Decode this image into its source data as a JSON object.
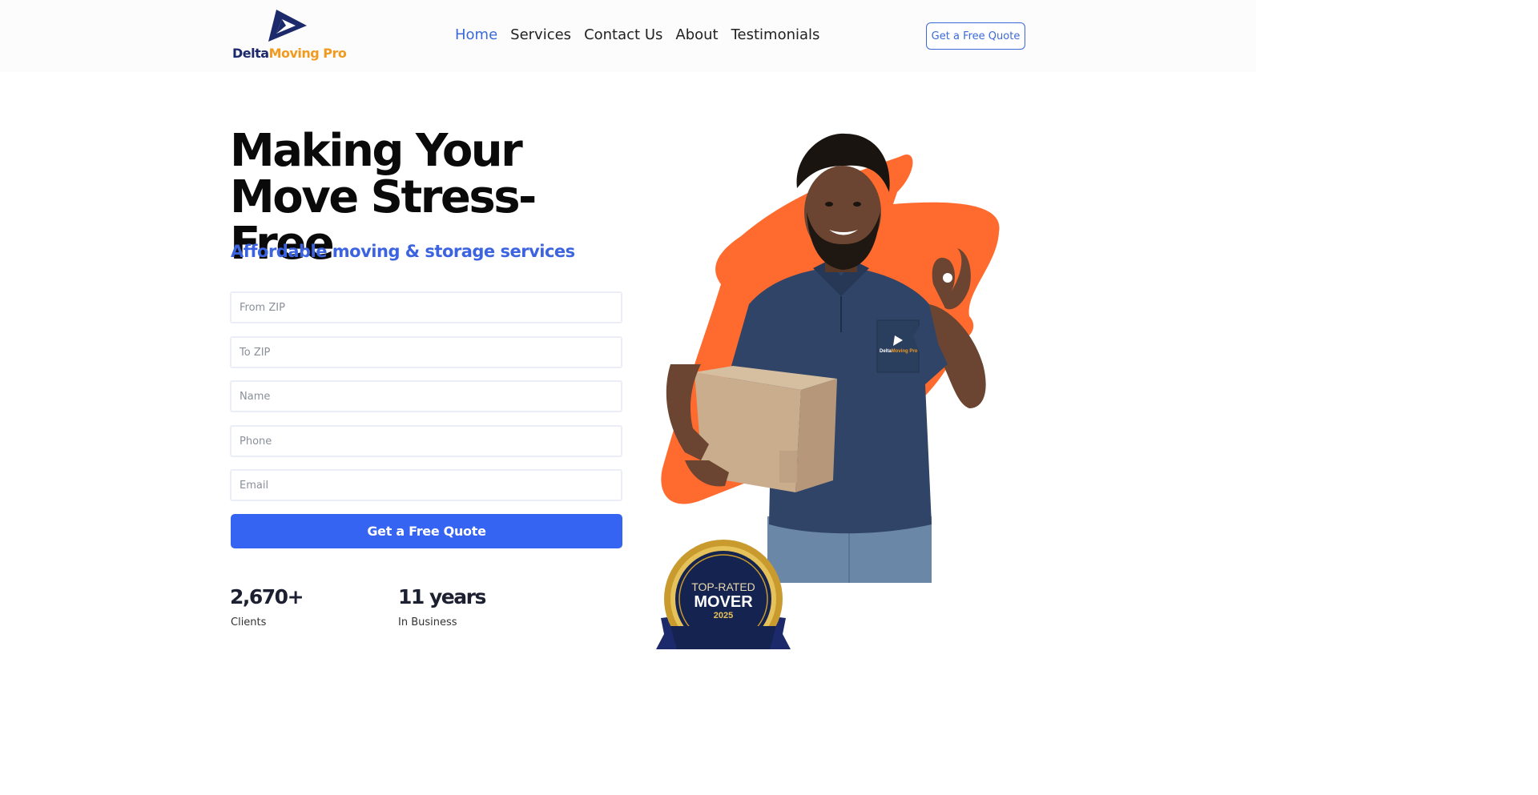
{
  "header": {
    "logo": {
      "name_part1": "Delta",
      "name_part2": "Moving Pro"
    },
    "nav": [
      {
        "label": "Home",
        "active": true
      },
      {
        "label": "Services",
        "active": false
      },
      {
        "label": "Contact Us",
        "active": false
      },
      {
        "label": "About",
        "active": false
      },
      {
        "label": "Testimonials",
        "active": false
      }
    ],
    "cta_label": "Get a Free Quote"
  },
  "hero": {
    "title": "Making Your Move Stress-Free",
    "subtitle": "Affordable moving & storage services",
    "form": {
      "from_zip_placeholder": "From ZIP",
      "to_zip_placeholder": "To ZIP",
      "name_placeholder": "Name",
      "phone_placeholder": "Phone",
      "email_placeholder": "Email",
      "submit_label": "Get a Free Quote"
    },
    "stats": [
      {
        "value": "2,670+",
        "label": "Clients"
      },
      {
        "value": "11 years",
        "label": "In Business"
      }
    ],
    "image": {
      "shirt_logo_part1": "Delta",
      "shirt_logo_part2": "Moving Pro"
    },
    "badge": {
      "line1": "TOP-RATED",
      "line2": "MOVER",
      "line3": "2025"
    }
  },
  "colors": {
    "accent": "#3563f2",
    "nav_active": "#3b6ad8",
    "logo_navy": "#1c2a6b",
    "logo_orange": "#f29a1f",
    "blob_orange": "#ff6a2e"
  }
}
